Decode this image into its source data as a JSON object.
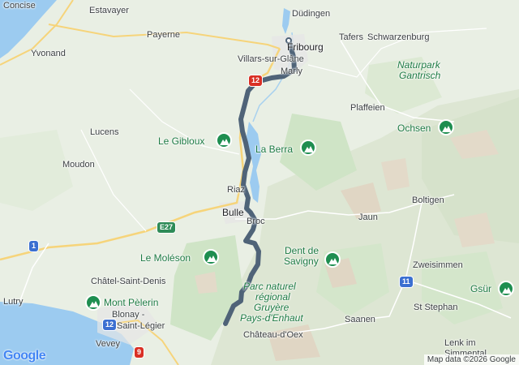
{
  "map": {
    "colors": {
      "land": "#e8efe3",
      "water": "#9ccbf0",
      "route": "#4f6378",
      "forest": "#c9e3c1",
      "mountain": "#d8cdb8"
    },
    "towns": {
      "concise": "Concise",
      "estavayer": "Estavayer",
      "dudingen": "Düdingen",
      "fribourg": "Fribourg",
      "tafers": "Tafers",
      "schwarzenburg": "Schwarzenburg",
      "payerne": "Payerne",
      "yvonand": "Yvonand",
      "villars": "Villars-sur-Glâne",
      "marly": "Marly",
      "plaffeien": "Plaffeien",
      "lucens": "Lucens",
      "moudon": "Moudon",
      "riaz": "Riaz",
      "bulle": "Bulle",
      "broc": "Broc",
      "jaun": "Jaun",
      "boltigen": "Boltigen",
      "zweisimmen": "Zweisimmen",
      "chatel": "Châtel-Saint-Denis",
      "lutry": "Lutry",
      "blonay": "Blonay -",
      "saint_legier": "Saint-Légier",
      "vevey": "Vevey",
      "saanen": "Saanen",
      "st_stephan": "St Stephan",
      "chateau_doex": "Château-d'Oex",
      "lenk": "Lenk im",
      "simmental": "Simmental"
    },
    "parks": {
      "gantrisch_1": "Naturpark",
      "gantrisch_2": "Gantrisch",
      "gruyere_1": "Parc naturel",
      "gruyere_2": "régional",
      "gruyere_3": "Gruyère",
      "gruyere_4": "Pays-d'Enhaut"
    },
    "peaks": {
      "ochsen": "Ochsen",
      "gibloux": "Le Gibloux",
      "berra": "La Berra",
      "moleson": "Le Moléson",
      "dent_1": "Dent de",
      "dent_2": "Savigny",
      "pelerin": "Mont Pèlerin",
      "gsur": "Gsür"
    },
    "roads": {
      "r12a": "12",
      "e27": "E27",
      "r1": "1",
      "r11": "11",
      "r12b": "12",
      "r9": "9"
    },
    "logo": "Google",
    "attribution": "Map data ©2026 Google"
  }
}
